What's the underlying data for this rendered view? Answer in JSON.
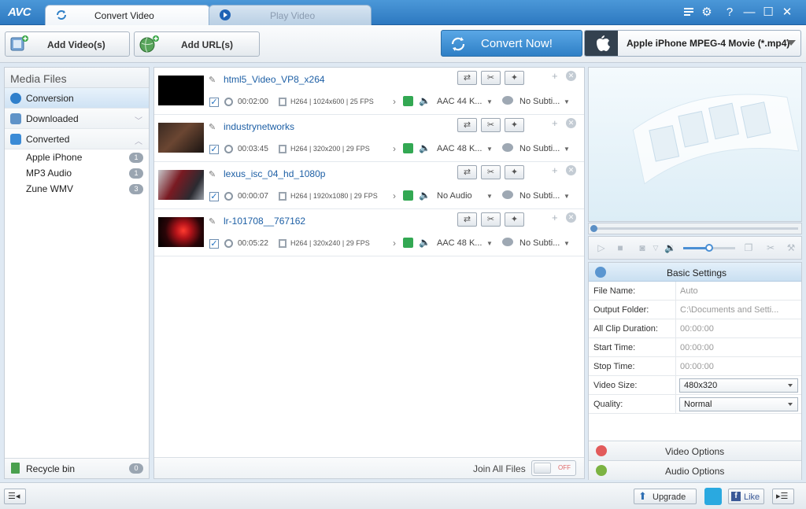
{
  "app": {
    "logo": "AVC"
  },
  "tabs": [
    {
      "label": "Convert Video",
      "active": true
    },
    {
      "label": "Play Video",
      "active": false
    }
  ],
  "toolbar": {
    "add_videos": "Add Video(s)",
    "add_urls": "Add URL(s)",
    "convert_now": "Convert Now!",
    "profile": "Apple iPhone MPEG-4 Movie (*.mp4)"
  },
  "sidebar": {
    "header": "Media Files",
    "items": [
      {
        "label": "Conversion",
        "selected": true
      },
      {
        "label": "Downloaded"
      },
      {
        "label": "Converted"
      }
    ],
    "converted_children": [
      {
        "label": "Apple iPhone",
        "count": "1"
      },
      {
        "label": "MP3 Audio",
        "count": "1"
      },
      {
        "label": "Zune WMV",
        "count": "3"
      }
    ],
    "recycle": {
      "label": "Recycle bin",
      "count": "0"
    }
  },
  "files": [
    {
      "name": "html5_Video_VP8_x264",
      "duration": "00:02:00",
      "video": "H264 | 1024x600 | 25 FPS",
      "audio": "AAC 44 K...",
      "subtitle": "No Subti..."
    },
    {
      "name": "industrynetworks",
      "duration": "00:03:45",
      "video": "H264 | 320x200 | 29 FPS",
      "audio": "AAC 48 K...",
      "subtitle": "No Subti..."
    },
    {
      "name": "lexus_isc_04_hd_1080p",
      "duration": "00:00:07",
      "video": "H264 | 1920x1080 | 29 FPS",
      "audio": "No Audio",
      "subtitle": "No Subti..."
    },
    {
      "name": "lr-101708__767162",
      "duration": "00:05:22",
      "video": "H264 | 320x240 | 29 FPS",
      "audio": "AAC 48 K...",
      "subtitle": "No Subti..."
    }
  ],
  "filelist_footer": {
    "join_label": "Join All Files",
    "toggle_state": "OFF"
  },
  "settings": {
    "header": "Basic Settings",
    "rows": [
      {
        "label": "File Name:",
        "value": "Auto"
      },
      {
        "label": "Output Folder:",
        "value": "C:\\Documents and Setti..."
      },
      {
        "label": "All Clip Duration:",
        "value": "00:00:00"
      },
      {
        "label": "Start Time:",
        "value": "00:00:00"
      },
      {
        "label": "Stop Time:",
        "value": "00:00:00"
      },
      {
        "label": "Video Size:",
        "value": "480x320"
      },
      {
        "label": "Quality:",
        "value": "Normal"
      }
    ],
    "video_options": "Video Options",
    "audio_options": "Audio Options"
  },
  "bottom": {
    "upgrade": "Upgrade",
    "like": "Like"
  },
  "colors": {
    "accent": "#2e7fc6",
    "link": "#1d5fa5",
    "titlebar": "#3a88cc"
  }
}
